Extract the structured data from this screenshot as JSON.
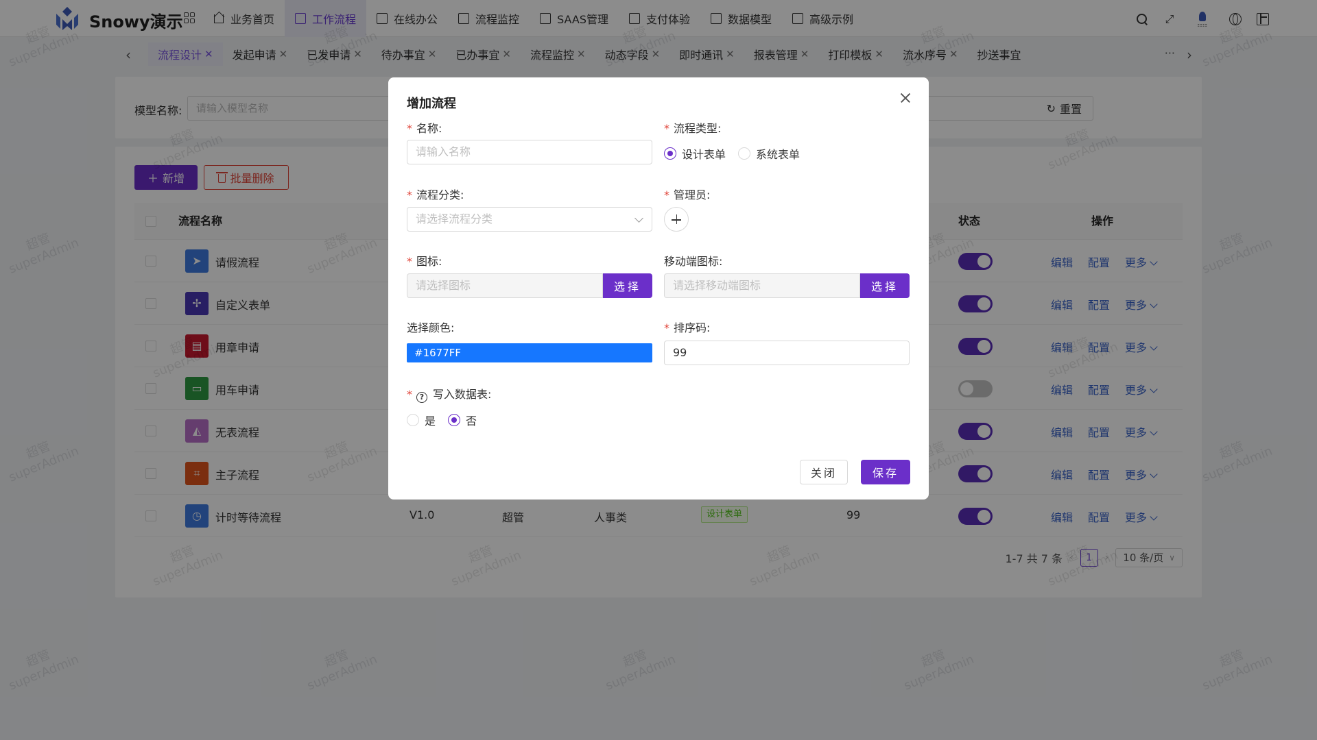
{
  "app": {
    "brand": "Snowy演示"
  },
  "nav": [
    {
      "label": "业务首页",
      "icon": "home-icon"
    },
    {
      "label": "工作流程",
      "icon": "workflow-icon",
      "active": true
    },
    {
      "label": "在线办公",
      "icon": "laptop-icon"
    },
    {
      "label": "流程监控",
      "icon": "monitor-icon"
    },
    {
      "label": "SAAS管理",
      "icon": "grid-icon"
    },
    {
      "label": "支付体验",
      "icon": "grid-icon"
    },
    {
      "label": "数据模型",
      "icon": "database-icon"
    },
    {
      "label": "高级示例",
      "icon": "code-icon"
    }
  ],
  "tabs": [
    "流程设计",
    "发起申请",
    "已发申请",
    "待办事宜",
    "已办事宜",
    "流程监控",
    "动态字段",
    "即时通讯",
    "报表管理",
    "打印模板",
    "流水序号",
    "抄送事宜"
  ],
  "tabs_more": "···",
  "search": {
    "label": "模型名称:",
    "placeholder": "请输入模型名称",
    "reset": "重置"
  },
  "toolbar": {
    "add": "新增",
    "batch_delete": "批量删除"
  },
  "table": {
    "headers": {
      "name": "流程名称",
      "status": "状态",
      "ops": "操作"
    },
    "ops": {
      "edit": "编辑",
      "config": "配置",
      "more": "更多"
    },
    "rows": [
      {
        "name": "请假流程",
        "color": "#3f7be0",
        "glyph": "➤",
        "on": true
      },
      {
        "name": "自定义表单",
        "color": "#4a37b5",
        "glyph": "✢",
        "on": true
      },
      {
        "name": "用章申请",
        "color": "#c8192f",
        "glyph": "▤",
        "on": true
      },
      {
        "name": "用车申请",
        "color": "#2e9a43",
        "glyph": "▭",
        "on": false
      },
      {
        "name": "无表流程",
        "color": "#b870c9",
        "glyph": "◭",
        "on": true
      },
      {
        "name": "主子流程",
        "color": "#e0551c",
        "glyph": "⌗",
        "on": true
      },
      {
        "name": "计时等待流程",
        "color": "#3f7be0",
        "glyph": "◷",
        "on": true,
        "version": "V1.0",
        "admin": "超管",
        "category": "人事类",
        "type_tag": "设计表单",
        "sort": "99"
      }
    ]
  },
  "pager": {
    "summary": "1-7 共 7 条",
    "current": "1",
    "size": "10 条/页"
  },
  "watermark": {
    "line1": "超管",
    "line2": "superAdmin"
  },
  "modal": {
    "title": "增加流程",
    "name_label": "名称:",
    "name_placeholder": "请输入名称",
    "type_label": "流程类型:",
    "type_options": [
      "设计表单",
      "系统表单"
    ],
    "type_selected": "设计表单",
    "category_label": "流程分类:",
    "category_placeholder": "请选择流程分类",
    "admin_label": "管理员:",
    "icon_label": "图标:",
    "icon_placeholder": "请选择图标",
    "mobile_icon_label": "移动端图标:",
    "mobile_icon_placeholder": "请选择移动端图标",
    "pick_button": "选择",
    "color_label": "选择颜色:",
    "color_value": "#1677FF",
    "sort_label": "排序码:",
    "sort_value": "99",
    "write_table_label": "写入数据表:",
    "write_table_options": [
      "是",
      "否"
    ],
    "write_table_selected": "否",
    "close_button": "关闭",
    "save_button": "保存"
  }
}
